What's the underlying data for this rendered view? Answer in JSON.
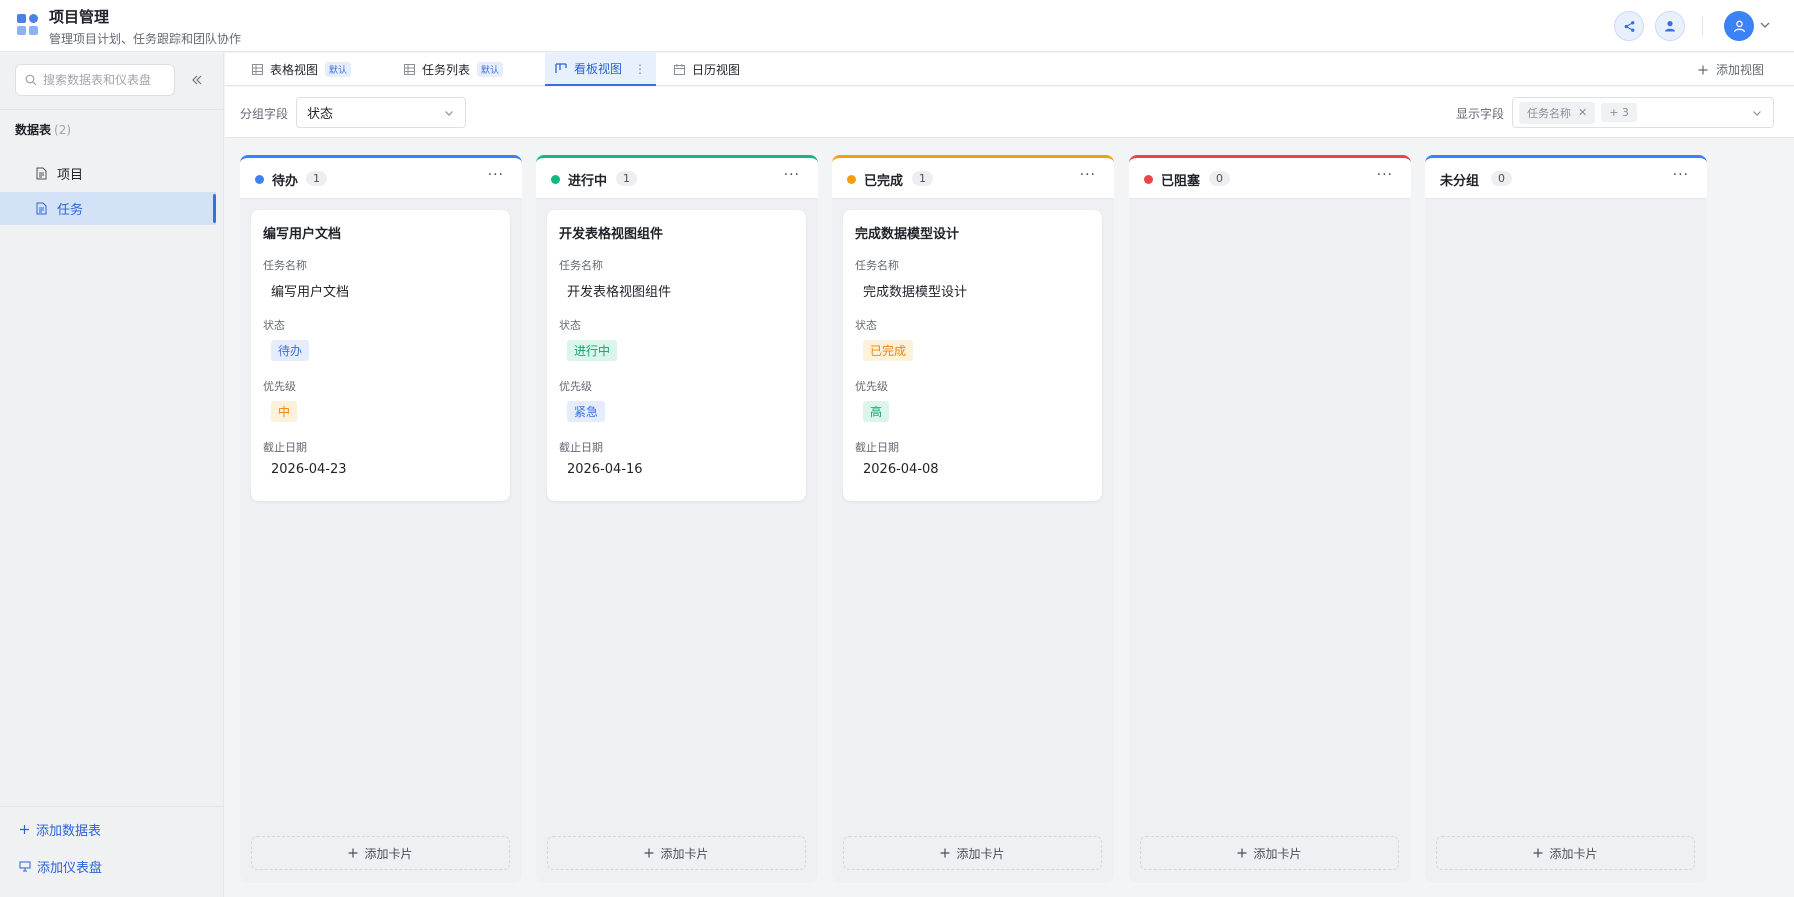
{
  "app": {
    "title": "项目管理",
    "subtitle": "管理项目计划、任务跟踪和团队协作"
  },
  "header": {
    "share_icon": "share-icon",
    "user_icon": "user-icon",
    "avatar_icon": "avatar-icon"
  },
  "sidebar": {
    "search_placeholder": "搜索数据表和仪表盘",
    "section_label": "数据表",
    "section_count": "(2)",
    "items": [
      {
        "label": "项目",
        "icon": "document-icon",
        "active": false
      },
      {
        "label": "任务",
        "icon": "document-icon",
        "active": true
      }
    ],
    "add_table": "添加数据表",
    "add_dashboard": "添加仪表盘"
  },
  "tabs": [
    {
      "label": "表格视图",
      "badge": "默认",
      "icon": "grid-icon",
      "active": false
    },
    {
      "label": "任务列表",
      "badge": "默认",
      "icon": "grid-icon",
      "active": false
    },
    {
      "label": "看板视图",
      "badge": "",
      "icon": "kanban-icon",
      "active": true
    },
    {
      "label": "日历视图",
      "badge": "",
      "icon": "calendar-icon",
      "active": false
    }
  ],
  "add_view": "添加视图",
  "toolbar": {
    "group_label": "分组字段",
    "group_value": "状态",
    "display_label": "显示字段",
    "display_chip": "任务名称",
    "display_more": "+ 3"
  },
  "colors": {
    "todo": "#3b82f6",
    "doing": "#10b981",
    "done": "#f59e0b",
    "blocked": "#ef4444",
    "ungrouped": "#3b82f6"
  },
  "columns": [
    {
      "title": "待办",
      "count": "1",
      "dot": "#3b82f6",
      "card": {
        "title": "编写用户文档",
        "name_label": "任务名称",
        "name": "编写用户文档",
        "status_label": "状态",
        "status": "待办",
        "priority_label": "优先级",
        "priority": "中",
        "due_label": "截止日期",
        "due": "2026-04-23"
      },
      "add_card": "添加卡片"
    },
    {
      "title": "进行中",
      "count": "1",
      "dot": "#10b981",
      "card": {
        "title": "开发表格视图组件",
        "name_label": "任务名称",
        "name": "开发表格视图组件",
        "status_label": "状态",
        "status": "进行中",
        "priority_label": "优先级",
        "priority": "紧急",
        "due_label": "截止日期",
        "due": "2026-04-16"
      },
      "add_card": "添加卡片"
    },
    {
      "title": "已完成",
      "count": "1",
      "dot": "#f59e0b",
      "card": {
        "title": "完成数据模型设计",
        "name_label": "任务名称",
        "name": "完成数据模型设计",
        "status_label": "状态",
        "status": "已完成",
        "priority_label": "优先级",
        "priority": "高",
        "due_label": "截止日期",
        "due": "2026-04-08"
      },
      "add_card": "添加卡片"
    },
    {
      "title": "已阻塞",
      "count": "0",
      "dot": "#ef4444",
      "add_card": "添加卡片"
    },
    {
      "title": "未分组",
      "count": "0",
      "dot": "",
      "add_card": "添加卡片"
    }
  ]
}
